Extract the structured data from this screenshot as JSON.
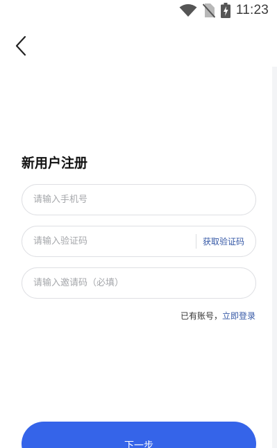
{
  "status_bar": {
    "time": "11:23",
    "icons": [
      "wifi-icon",
      "no-sim-icon",
      "battery-charging-icon"
    ]
  },
  "nav": {
    "back_icon": "chevron-left-icon"
  },
  "form": {
    "title": "新用户注册",
    "phone_placeholder": "请输入手机号",
    "code_placeholder": "请输入验证码",
    "get_code_label": "获取验证码",
    "invite_placeholder": "请输入邀请码（必填）",
    "have_account_text": "已有账号，",
    "login_link": "立即登录",
    "next_label": "下一步"
  },
  "colors": {
    "accent": "#3564e9",
    "link": "#3558a6",
    "input_border": "#dedfe3",
    "placeholder": "#a5a7ab"
  }
}
